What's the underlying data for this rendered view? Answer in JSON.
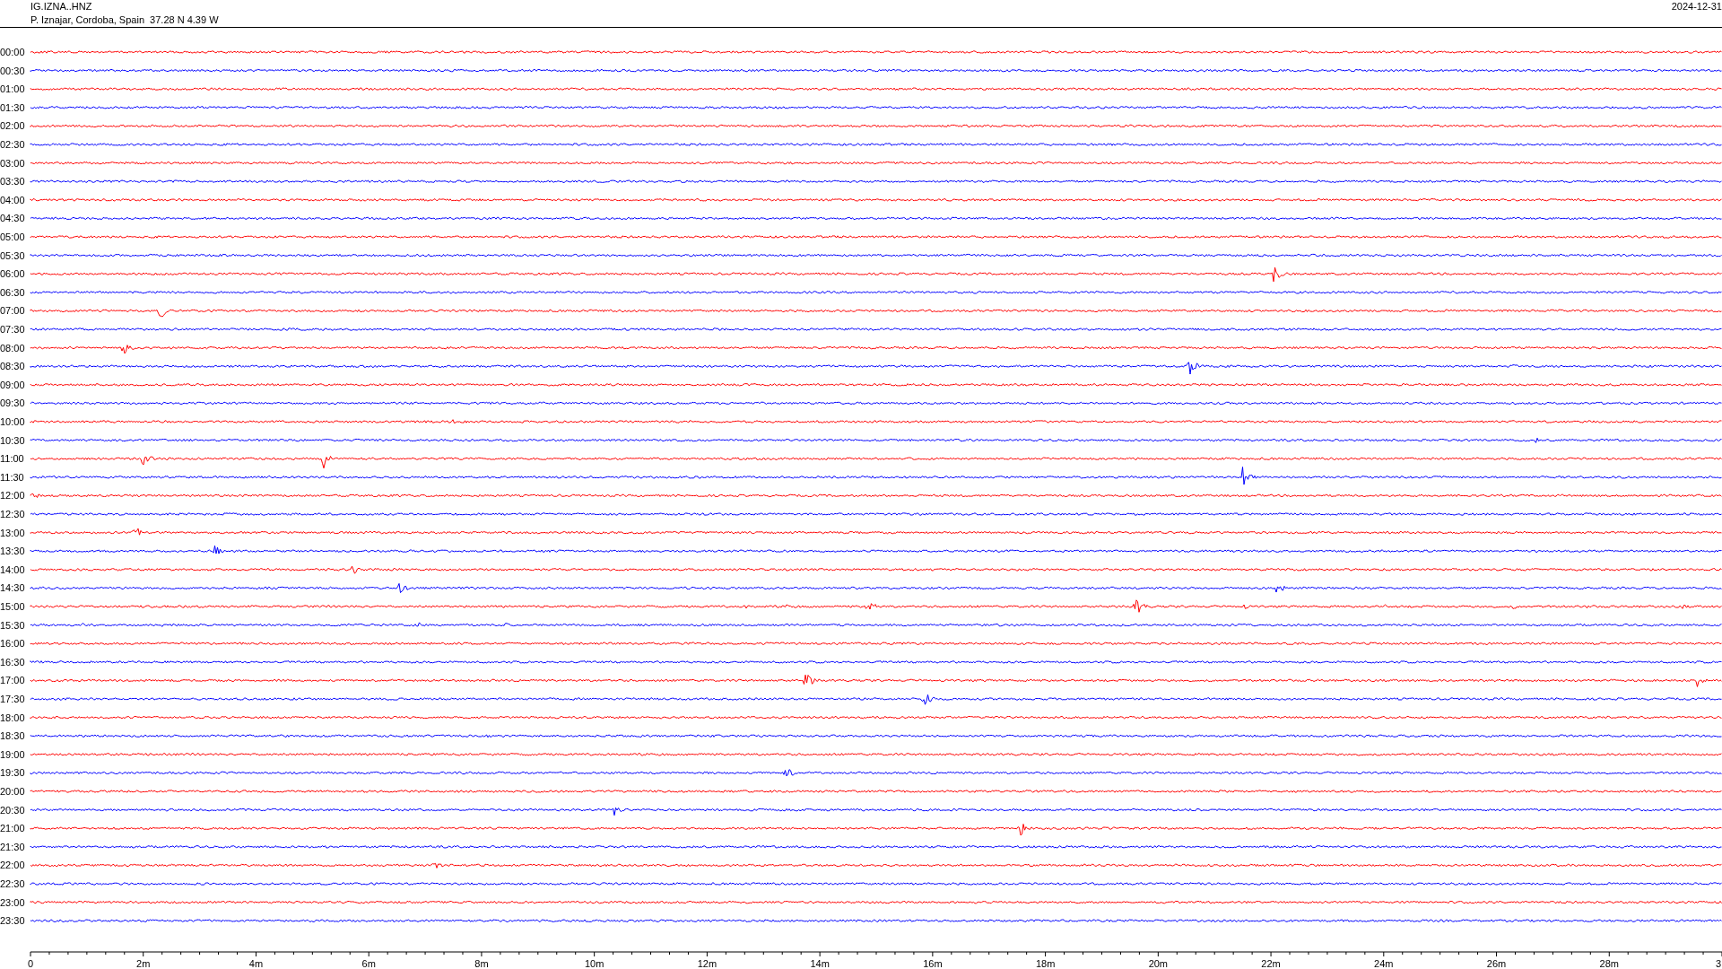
{
  "header": {
    "station": "IG.IZNA..HNZ",
    "location": "P. Iznajar, Cordoba, Spain  37.28 N 4.39 W",
    "date": "2024-12-31"
  },
  "rows": [
    {
      "label": "00:00",
      "color": "#ff0000"
    },
    {
      "label": "00:30",
      "color": "#0000ff"
    },
    {
      "label": "01:00",
      "color": "#ff0000"
    },
    {
      "label": "01:30",
      "color": "#0000ff"
    },
    {
      "label": "02:00",
      "color": "#ff0000"
    },
    {
      "label": "02:30",
      "color": "#0000ff"
    },
    {
      "label": "03:00",
      "color": "#ff0000"
    },
    {
      "label": "03:30",
      "color": "#0000ff"
    },
    {
      "label": "04:00",
      "color": "#ff0000"
    },
    {
      "label": "04:30",
      "color": "#0000ff"
    },
    {
      "label": "05:00",
      "color": "#ff0000"
    },
    {
      "label": "05:30",
      "color": "#0000ff"
    },
    {
      "label": "06:00",
      "color": "#ff0000"
    },
    {
      "label": "06:30",
      "color": "#0000ff"
    },
    {
      "label": "07:00",
      "color": "#ff0000"
    },
    {
      "label": "07:30",
      "color": "#0000ff"
    },
    {
      "label": "08:00",
      "color": "#ff0000"
    },
    {
      "label": "08:30",
      "color": "#0000ff"
    },
    {
      "label": "09:00",
      "color": "#ff0000"
    },
    {
      "label": "09:30",
      "color": "#0000ff"
    },
    {
      "label": "10:00",
      "color": "#ff0000"
    },
    {
      "label": "10:30",
      "color": "#0000ff"
    },
    {
      "label": "11:00",
      "color": "#ff0000"
    },
    {
      "label": "11:30",
      "color": "#0000ff"
    },
    {
      "label": "12:00",
      "color": "#ff0000"
    },
    {
      "label": "12:30",
      "color": "#0000ff"
    },
    {
      "label": "13:00",
      "color": "#ff0000"
    },
    {
      "label": "13:30",
      "color": "#0000ff"
    },
    {
      "label": "14:00",
      "color": "#ff0000"
    },
    {
      "label": "14:30",
      "color": "#0000ff"
    },
    {
      "label": "15:00",
      "color": "#ff0000"
    },
    {
      "label": "15:30",
      "color": "#0000ff"
    },
    {
      "label": "16:00",
      "color": "#ff0000"
    },
    {
      "label": "16:30",
      "color": "#0000ff"
    },
    {
      "label": "17:00",
      "color": "#ff0000"
    },
    {
      "label": "17:30",
      "color": "#0000ff"
    },
    {
      "label": "18:00",
      "color": "#ff0000"
    },
    {
      "label": "18:30",
      "color": "#0000ff"
    },
    {
      "label": "19:00",
      "color": "#ff0000"
    },
    {
      "label": "19:30",
      "color": "#0000ff"
    },
    {
      "label": "20:00",
      "color": "#ff0000"
    },
    {
      "label": "20:30",
      "color": "#0000ff"
    },
    {
      "label": "21:00",
      "color": "#ff0000"
    },
    {
      "label": "21:30",
      "color": "#0000ff"
    },
    {
      "label": "22:00",
      "color": "#ff0000"
    },
    {
      "label": "22:30",
      "color": "#0000ff"
    },
    {
      "label": "23:00",
      "color": "#ff0000"
    },
    {
      "label": "23:30",
      "color": "#0000ff"
    }
  ],
  "x_axis": {
    "ticks": [
      "0",
      "2m",
      "4m",
      "6m",
      "8m",
      "10m",
      "12m",
      "14m",
      "16m",
      "18m",
      "20m",
      "22m",
      "24m",
      "26m",
      "28m",
      "3"
    ]
  }
}
